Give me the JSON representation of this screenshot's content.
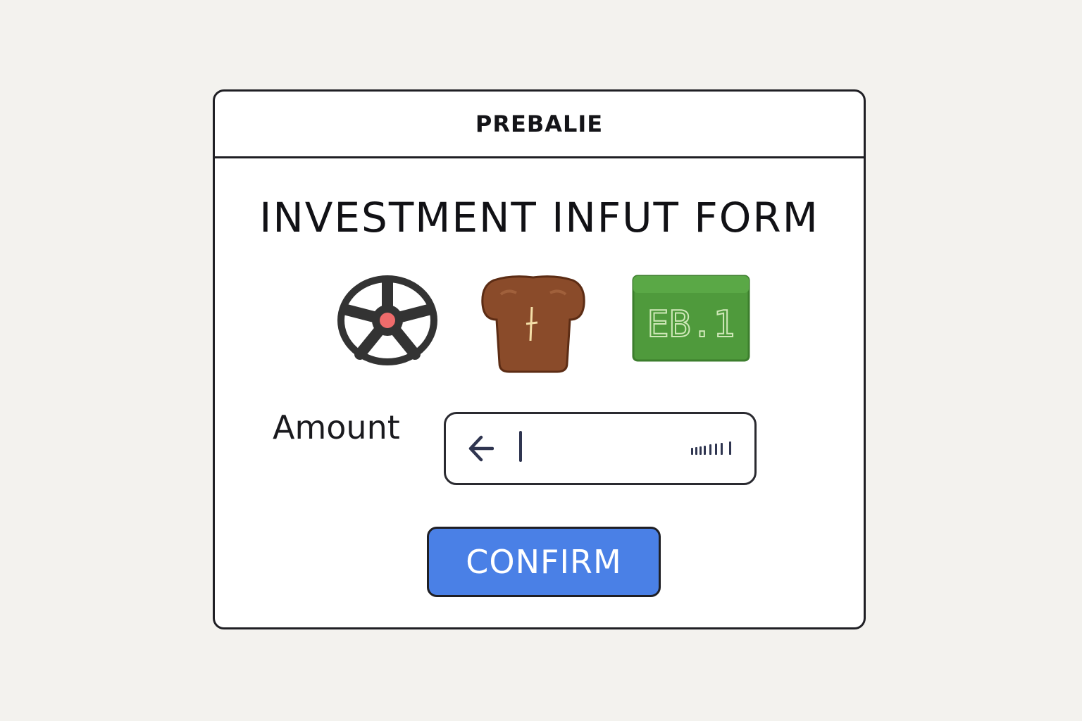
{
  "window": {
    "title": "PREBALIE"
  },
  "form": {
    "title": "INVESTMENT INFUT FORM",
    "assets": [
      {
        "icon": "soccer-ball-icon",
        "color": "#333333"
      },
      {
        "icon": "brown-shirt-icon",
        "color": "#8a4b2a"
      },
      {
        "icon": "green-box-icon",
        "text": "EB.1",
        "color": "#4f9a3c"
      }
    ],
    "amount": {
      "label": "Amount",
      "value": "",
      "placeholder": "",
      "back_icon": "arrow-left-icon",
      "trailing_icon": "signal-bars-icon"
    },
    "confirm_label": "CONFIRM"
  },
  "colors": {
    "background": "#f3f2ee",
    "window": "#ffffff",
    "border": "#1f1f24",
    "accent": "#4a80e6"
  }
}
